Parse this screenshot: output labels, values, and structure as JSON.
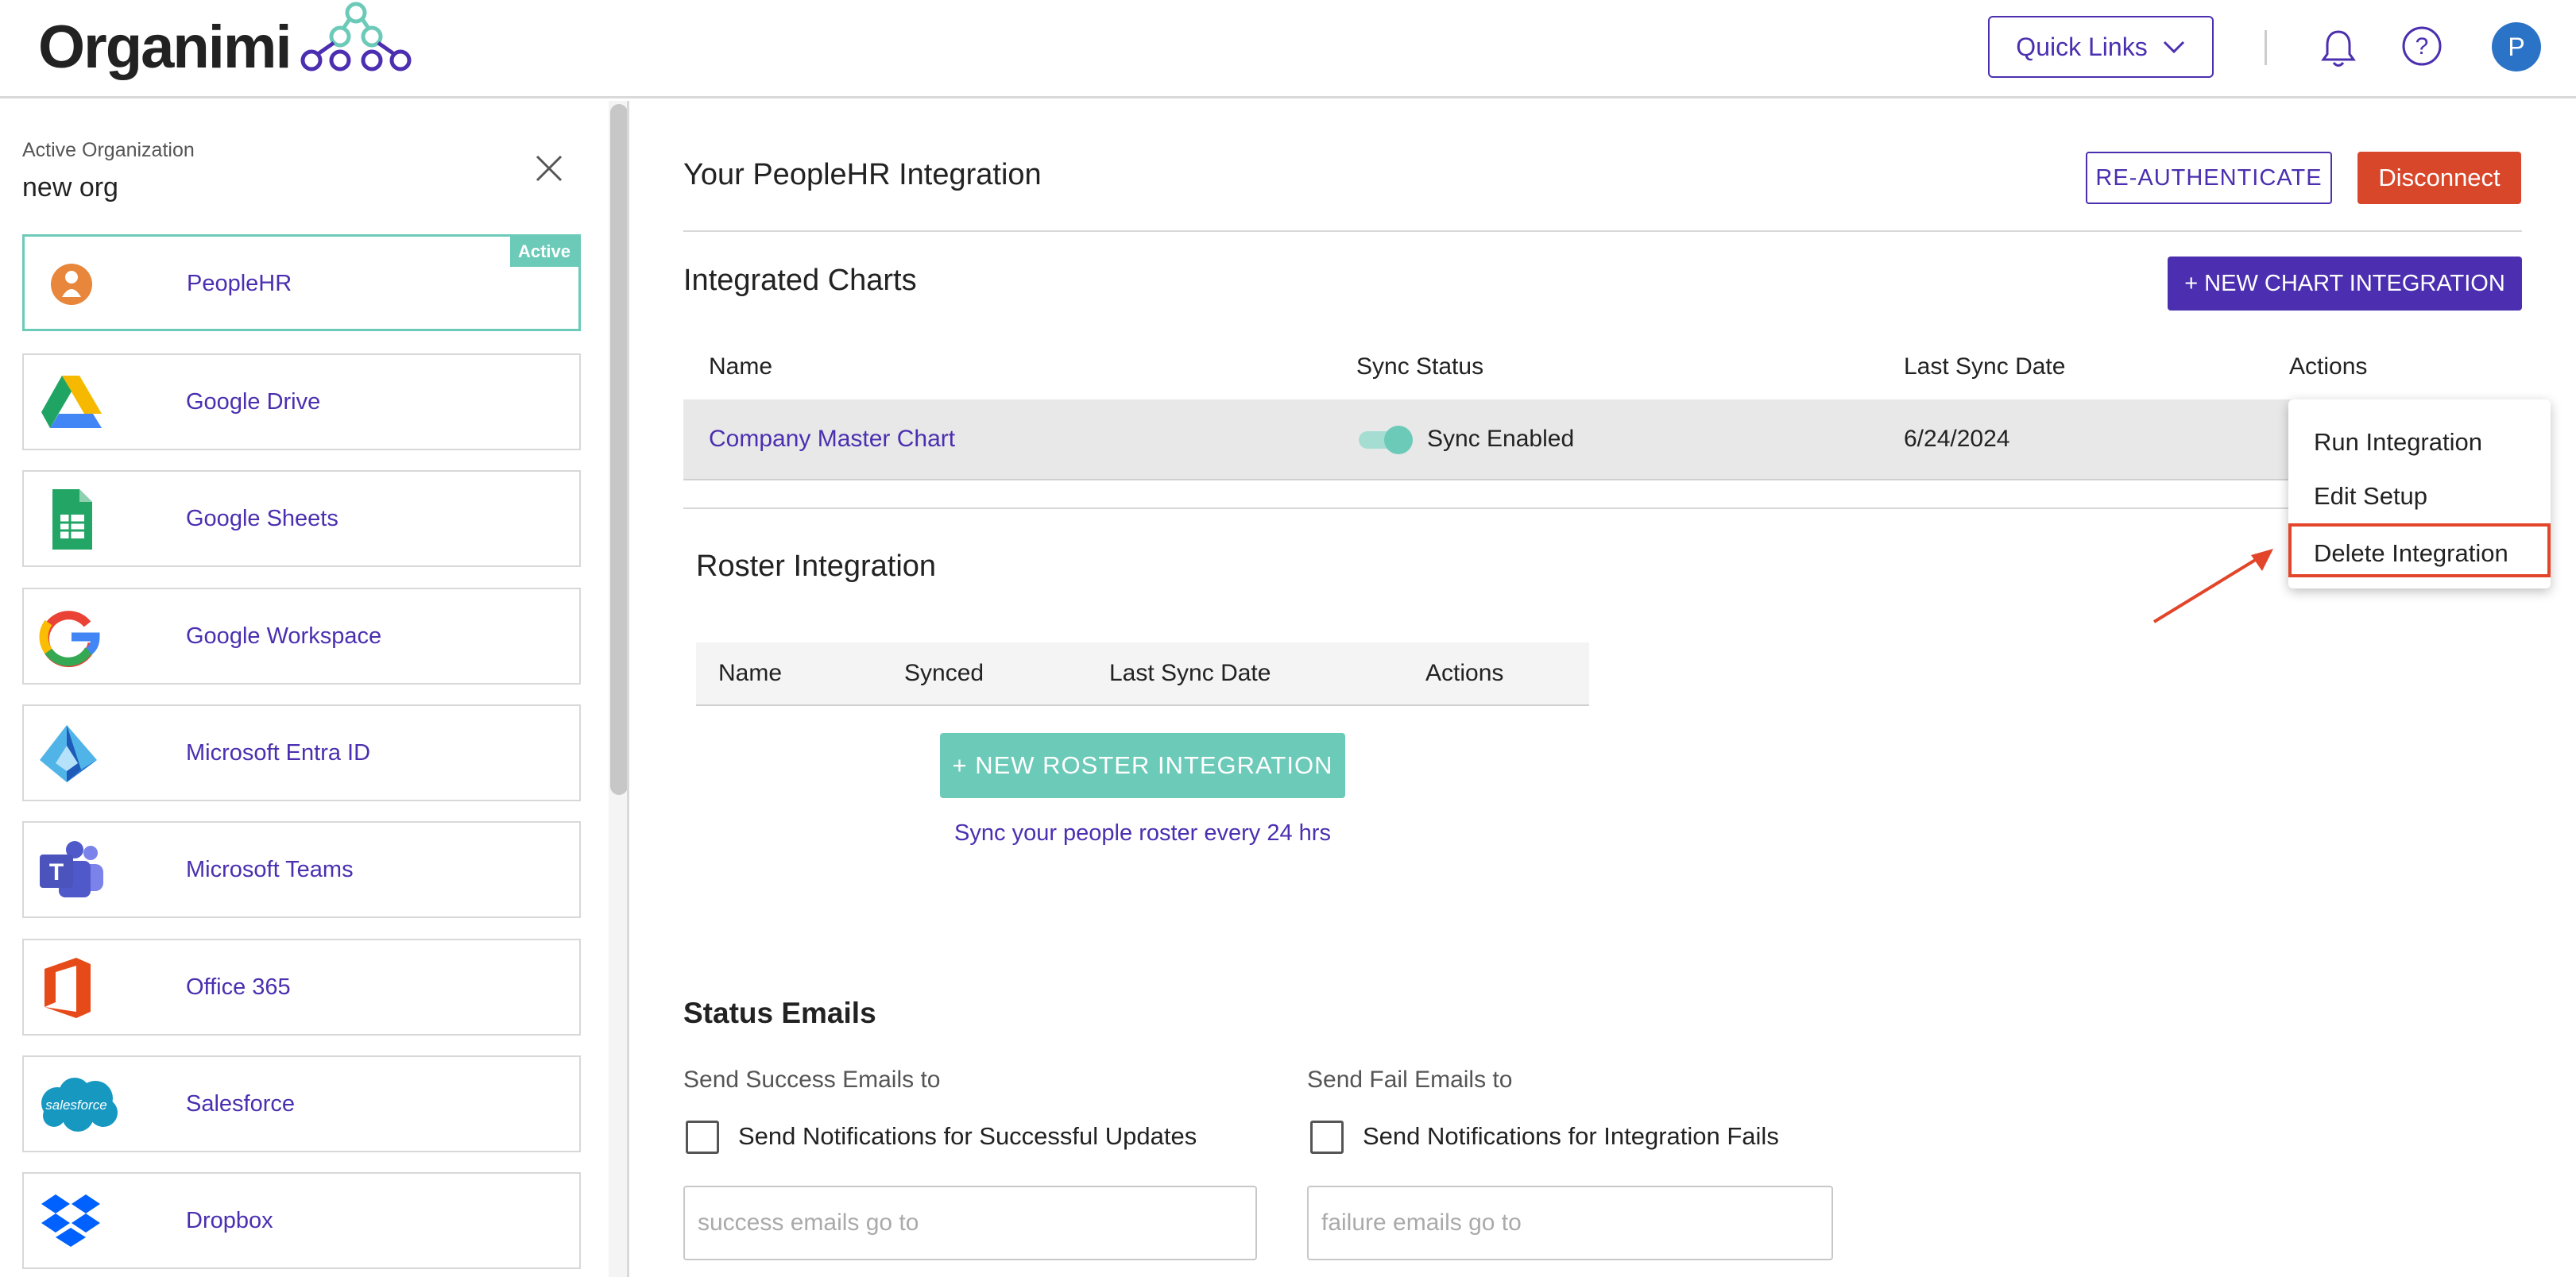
{
  "header": {
    "logo_text": "Organimi",
    "quick_links_label": "Quick Links",
    "avatar_initial": "P"
  },
  "sidebar": {
    "org_label": "Active Organization",
    "org_name": "new org",
    "active_badge": "Active",
    "items": [
      {
        "label": "PeopleHR",
        "icon": "peoplehr-icon",
        "active": true
      },
      {
        "label": "Google Drive",
        "icon": "google-drive-icon"
      },
      {
        "label": "Google Sheets",
        "icon": "google-sheets-icon"
      },
      {
        "label": "Google Workspace",
        "icon": "google-workspace-icon"
      },
      {
        "label": "Microsoft Entra ID",
        "icon": "microsoft-entra-icon"
      },
      {
        "label": "Microsoft Teams",
        "icon": "microsoft-teams-icon"
      },
      {
        "label": "Office 365",
        "icon": "office-365-icon"
      },
      {
        "label": "Salesforce",
        "icon": "salesforce-icon",
        "icon_text": "salesforce"
      },
      {
        "label": "Dropbox",
        "icon": "dropbox-icon"
      }
    ]
  },
  "main": {
    "title": "Your PeopleHR Integration",
    "reauth_label": "RE-AUTHENTICATE",
    "disconnect_label": "Disconnect",
    "charts": {
      "title": "Integrated Charts",
      "new_button": "+ NEW CHART INTEGRATION",
      "columns": [
        "Name",
        "Sync Status",
        "Last Sync Date",
        "Actions"
      ],
      "rows": [
        {
          "name": "Company Master Chart",
          "sync_status": "Sync Enabled",
          "sync_on": true,
          "last_sync": "6/24/2024"
        }
      ]
    },
    "actions_menu": {
      "items": [
        "Run Integration",
        "Edit Setup",
        "Delete Integration"
      ],
      "highlighted": "Delete Integration"
    },
    "roster": {
      "title": "Roster Integration",
      "columns": [
        "Name",
        "Synced",
        "Last Sync Date",
        "Actions"
      ],
      "new_button": "+ NEW ROSTER INTEGRATION",
      "subtext": "Sync your people roster every 24 hrs"
    },
    "status_emails": {
      "title": "Status Emails",
      "success_label": "Send Success Emails to",
      "success_checkbox": "Send Notifications for Successful Updates",
      "success_placeholder": "success emails go to",
      "fail_label": "Send Fail Emails to",
      "fail_checkbox": "Send Notifications for Integration Fails",
      "fail_placeholder": "failure emails go to"
    }
  },
  "colors": {
    "primary": "#4b2fb0",
    "teal": "#6ccab8",
    "danger": "#d9472b",
    "highlight": "#e2452a"
  }
}
